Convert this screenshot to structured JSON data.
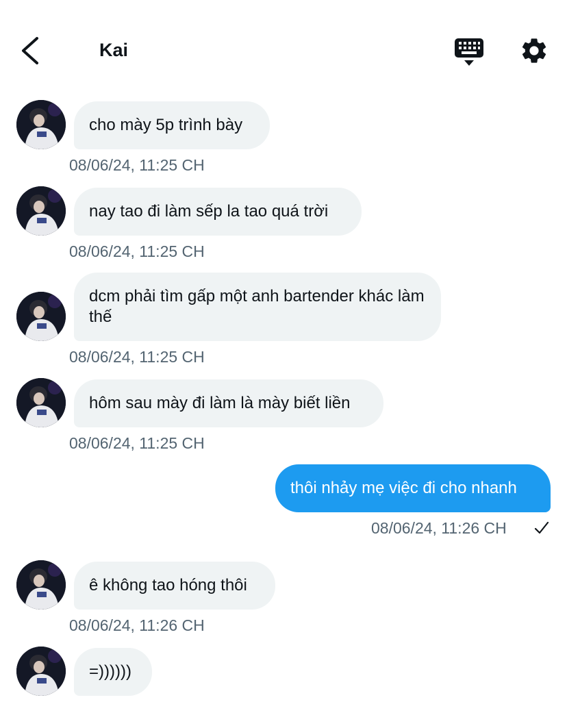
{
  "header": {
    "title": "Kai",
    "icons": [
      "back-arrow-icon",
      "keyboard-icon",
      "gear-icon"
    ]
  },
  "colors": {
    "incoming_bubble": "#eff3f4",
    "outgoing_bubble": "#1d9bf0",
    "timestamp": "#536471"
  },
  "messages": [
    {
      "direction": "in",
      "text": "cho mày 5p trình bày",
      "time": "08/06/24, 11:25 CH"
    },
    {
      "direction": "in",
      "text": "nay tao đi làm sếp la tao quá trời",
      "time": "08/06/24, 11:25 CH"
    },
    {
      "direction": "in",
      "text": "dcm phải tìm gấp một anh bartender khác làm thế",
      "time": "08/06/24, 11:25 CH"
    },
    {
      "direction": "in",
      "text": "hôm sau mày đi làm là mày biết liền",
      "time": "08/06/24, 11:25 CH"
    },
    {
      "direction": "out",
      "text": "thôi nhảy mẹ việc đi cho nhanh",
      "time": "08/06/24, 11:26 CH",
      "status_icon": "checkmark-icon"
    },
    {
      "direction": "in",
      "text": "ê không tao hóng thôi",
      "time": "08/06/24, 11:26 CH"
    },
    {
      "direction": "in",
      "text": "=))))))"
    }
  ]
}
